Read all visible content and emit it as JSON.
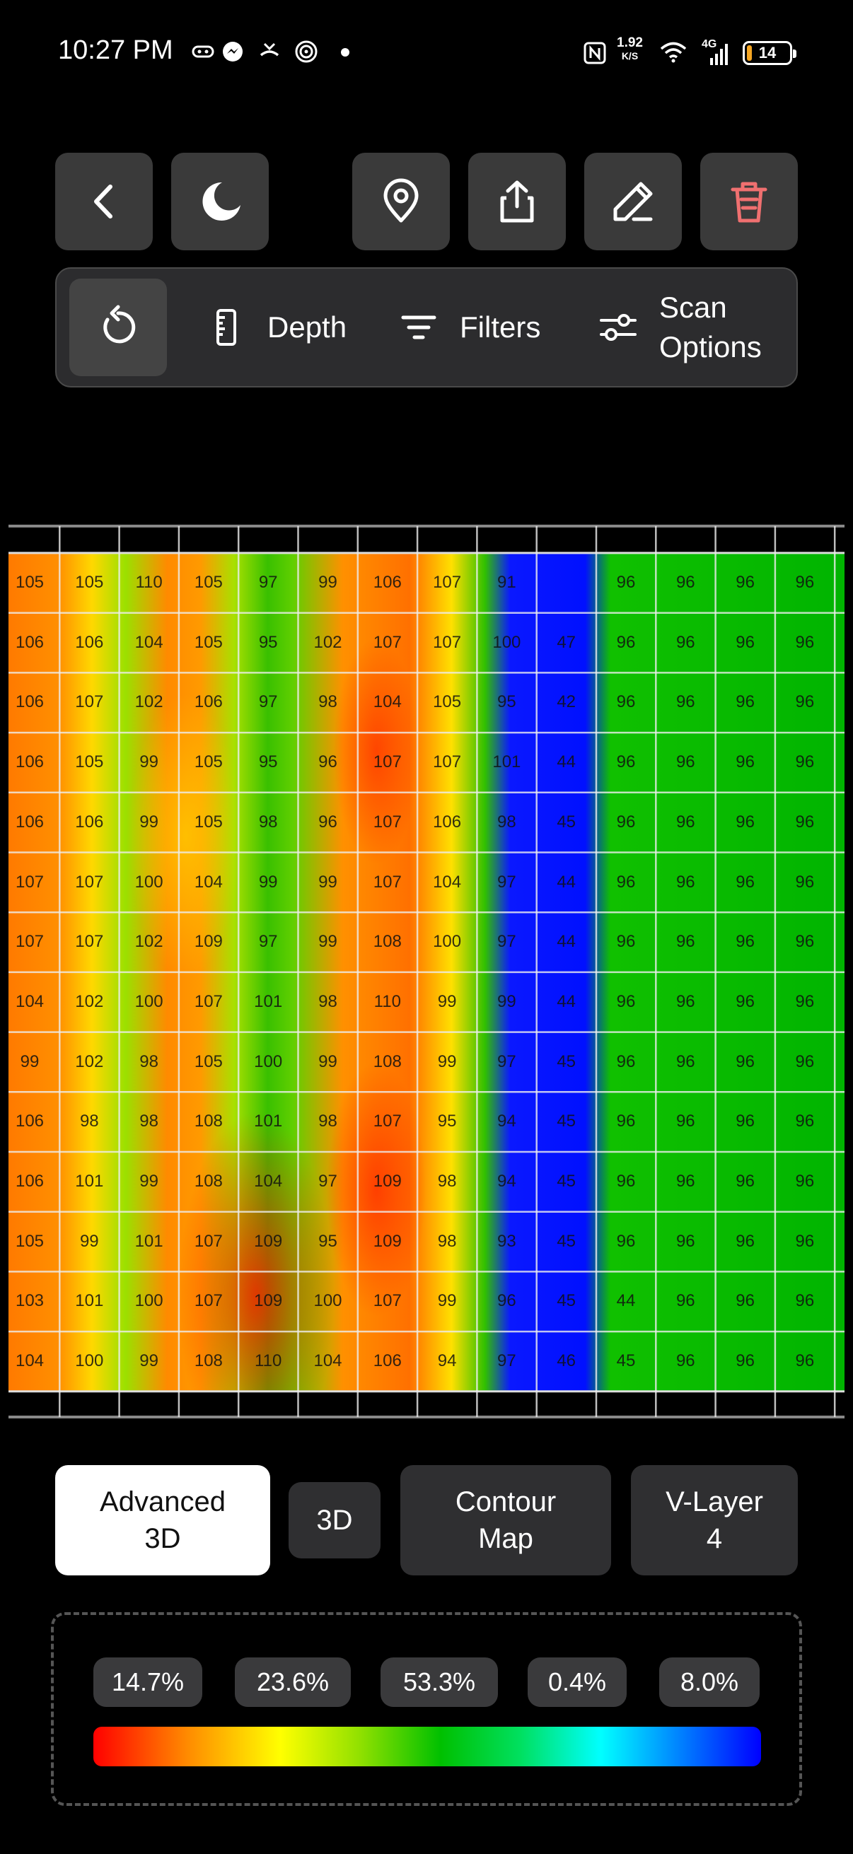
{
  "status_bar": {
    "time": "10:27 PM",
    "net_speed": "1.92",
    "net_unit": "K/S",
    "network_type": "4G",
    "battery": "14"
  },
  "top_bar": {
    "icons": [
      "back-icon",
      "moon-icon",
      "location-pin-icon",
      "share-icon",
      "edit-icon",
      "trash-icon"
    ]
  },
  "toolbar": {
    "depth_label": "Depth",
    "filters_label": "Filters",
    "scan_options_line1": "Scan",
    "scan_options_line2": "Options"
  },
  "grid": {
    "rows": [
      [
        "105",
        "105",
        "110",
        "105",
        "97",
        "99",
        "106",
        "107",
        "91",
        "",
        "96",
        "96",
        "96",
        "96"
      ],
      [
        "106",
        "106",
        "104",
        "105",
        "95",
        "102",
        "107",
        "107",
        "100",
        "47",
        "96",
        "96",
        "96",
        "96"
      ],
      [
        "106",
        "107",
        "102",
        "106",
        "97",
        "98",
        "104",
        "105",
        "95",
        "42",
        "96",
        "96",
        "96",
        "96"
      ],
      [
        "106",
        "105",
        "99",
        "105",
        "95",
        "96",
        "107",
        "107",
        "101",
        "44",
        "96",
        "96",
        "96",
        "96"
      ],
      [
        "106",
        "106",
        "99",
        "105",
        "98",
        "96",
        "107",
        "106",
        "98",
        "45",
        "96",
        "96",
        "96",
        "96"
      ],
      [
        "107",
        "107",
        "100",
        "104",
        "99",
        "99",
        "107",
        "104",
        "97",
        "44",
        "96",
        "96",
        "96",
        "96"
      ],
      [
        "107",
        "107",
        "102",
        "109",
        "97",
        "99",
        "108",
        "100",
        "97",
        "44",
        "96",
        "96",
        "96",
        "96"
      ],
      [
        "104",
        "102",
        "100",
        "107",
        "101",
        "98",
        "110",
        "99",
        "99",
        "44",
        "96",
        "96",
        "96",
        "96"
      ],
      [
        "99",
        "102",
        "98",
        "105",
        "100",
        "99",
        "108",
        "99",
        "97",
        "45",
        "96",
        "96",
        "96",
        "96"
      ],
      [
        "106",
        "98",
        "98",
        "108",
        "101",
        "98",
        "107",
        "95",
        "94",
        "45",
        "96",
        "96",
        "96",
        "96"
      ],
      [
        "106",
        "101",
        "99",
        "108",
        "104",
        "97",
        "109",
        "98",
        "94",
        "45",
        "96",
        "96",
        "96",
        "96"
      ],
      [
        "105",
        "99",
        "101",
        "107",
        "109",
        "95",
        "109",
        "98",
        "93",
        "45",
        "96",
        "96",
        "96",
        "96"
      ],
      [
        "103",
        "101",
        "100",
        "107",
        "109",
        "100",
        "107",
        "99",
        "96",
        "45",
        "44",
        "96",
        "96",
        "96"
      ],
      [
        "104",
        "100",
        "99",
        "108",
        "110",
        "104",
        "106",
        "94",
        "97",
        "46",
        "45",
        "96",
        "96",
        "96"
      ]
    ],
    "colors": {
      "high": "#ff2000",
      "mid": "#00b400",
      "low": "#0010ff"
    }
  },
  "modes": {
    "advanced_line1": "Advanced",
    "advanced_line2": "3D",
    "three_d": "3D",
    "contour_line1": "Contour",
    "contour_line2": "Map",
    "vlayer_line1": "V-Layer",
    "vlayer_line2": "4"
  },
  "legend": {
    "percentages": [
      "14.7%",
      "23.6%",
      "53.3%",
      "0.4%",
      "8.0%"
    ]
  }
}
